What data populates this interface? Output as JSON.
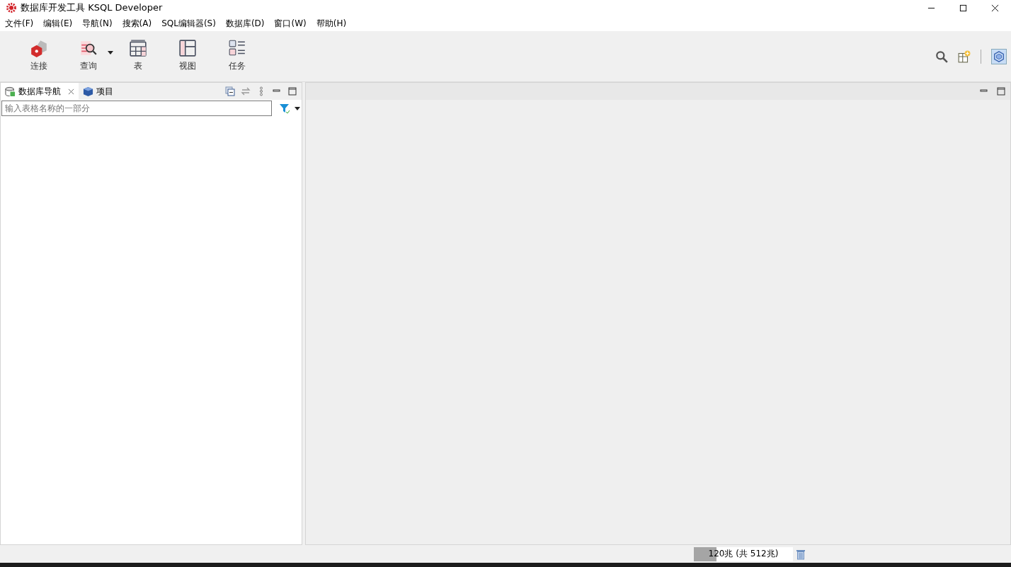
{
  "window": {
    "title": "数据库开发工具 KSQL Developer"
  },
  "menu": [
    "文件(F)",
    "编辑(E)",
    "导航(N)",
    "搜索(A)",
    "SQL编辑器(S)",
    "数据库(D)",
    "窗口(W)",
    "帮助(H)"
  ],
  "toolbar": [
    {
      "kind": "connect",
      "label": "连接"
    },
    {
      "kind": "query",
      "label": "查询"
    },
    {
      "kind": "table",
      "label": "表"
    },
    {
      "kind": "view",
      "label": "视图"
    },
    {
      "kind": "task",
      "label": "任务"
    }
  ],
  "left_panel": {
    "tabs": [
      {
        "label": "数据库导航",
        "selected": true
      },
      {
        "label": "项目",
        "selected": false
      }
    ],
    "filter": {
      "placeholder": "输入表格名称的一部分"
    }
  },
  "status_bar": {
    "memory": "120兆 (共 512兆)",
    "level": 0.23
  }
}
